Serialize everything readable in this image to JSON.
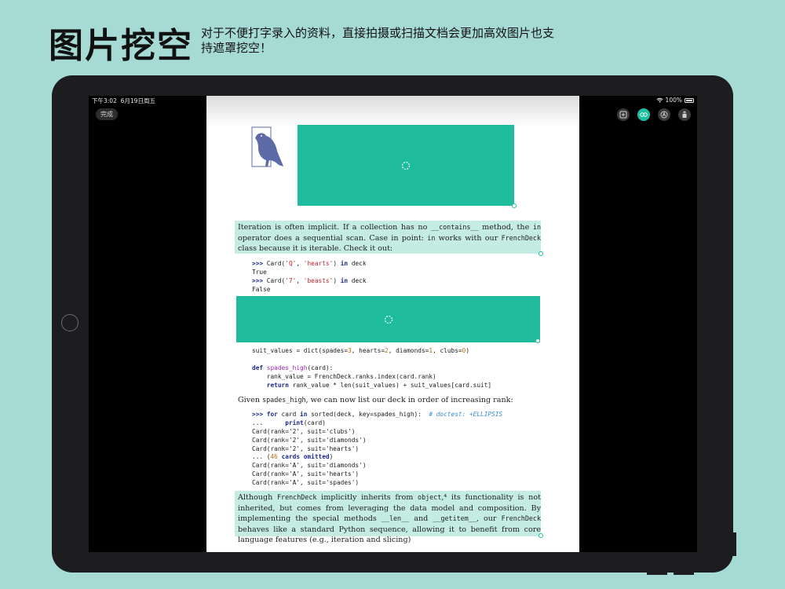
{
  "header": {
    "title": "图片挖空",
    "subtitle": "对于不便打字录入的资料，直接拍摄或扫描文档会更加高效图片也支持遮罩挖空！"
  },
  "status_bar": {
    "time": "下午3:02",
    "date": "6月19日周五",
    "battery": "100%"
  },
  "toolbar": {
    "done_label": "完成",
    "tools": [
      "add-icon",
      "mask-icon",
      "pen-icon",
      "share-icon"
    ],
    "active_tool": "mask-icon"
  },
  "colors": {
    "background": "#a6dad5",
    "mask": "#1ebc9d",
    "highlight": "#c4ece2"
  },
  "document": {
    "para1": {
      "t1": "Iteration is often implicit. If a collection has no ",
      "c1": "__contains__",
      "t2": " method, the ",
      "c2": "in",
      "t3": " operator does a sequential scan. Case in point: ",
      "c3": "in",
      "t4": " works with our ",
      "c4": "FrenchDeck",
      "t5": " class because it is iterable. Check it out:"
    },
    "code1": [
      [
        {
          "c": "kw",
          "t": ">>> "
        },
        {
          "c": "",
          "t": "Card("
        },
        {
          "c": "str",
          "t": "'Q'"
        },
        {
          "c": "",
          "t": ", "
        },
        {
          "c": "str",
          "t": "'hearts'"
        },
        {
          "c": "",
          "t": ") "
        },
        {
          "c": "kw",
          "t": "in"
        },
        {
          "c": "",
          "t": " deck"
        }
      ],
      [
        {
          "c": "",
          "t": "True"
        }
      ],
      [
        {
          "c": "kw",
          "t": ">>> "
        },
        {
          "c": "",
          "t": "Card("
        },
        {
          "c": "str",
          "t": "'7'"
        },
        {
          "c": "",
          "t": ", "
        },
        {
          "c": "str",
          "t": "'beasts'"
        },
        {
          "c": "",
          "t": ") "
        },
        {
          "c": "kw",
          "t": "in"
        },
        {
          "c": "",
          "t": " deck"
        }
      ],
      [
        {
          "c": "",
          "t": "False"
        }
      ]
    ],
    "code2": [
      [
        {
          "c": "",
          "t": "suit_values = dict(spades="
        },
        {
          "c": "num",
          "t": "3"
        },
        {
          "c": "",
          "t": ", hearts="
        },
        {
          "c": "num",
          "t": "2"
        },
        {
          "c": "",
          "t": ", diamonds="
        },
        {
          "c": "num",
          "t": "1"
        },
        {
          "c": "",
          "t": ", clubs="
        },
        {
          "c": "num",
          "t": "0"
        },
        {
          "c": "",
          "t": ")"
        }
      ],
      [
        {
          "c": "",
          "t": " "
        }
      ],
      [
        {
          "c": "kw",
          "t": "def"
        },
        {
          "c": "",
          "t": " "
        },
        {
          "c": "fn",
          "t": "spades_high"
        },
        {
          "c": "",
          "t": "(card):"
        }
      ],
      [
        {
          "c": "",
          "t": "    rank_value = FrenchDeck.ranks.index(card.rank)"
        }
      ],
      [
        {
          "c": "",
          "t": "    "
        },
        {
          "c": "kw",
          "t": "return"
        },
        {
          "c": "",
          "t": " rank_value * len(suit_values) + suit_values[card.suit]"
        }
      ]
    ],
    "para2": {
      "t1": "Given ",
      "c1": "spades_high",
      "t2": ", we can now list our deck in order of increasing rank:"
    },
    "code3": [
      [
        {
          "c": "kw",
          "t": ">>> for"
        },
        {
          "c": "",
          "t": " card "
        },
        {
          "c": "kw",
          "t": "in"
        },
        {
          "c": "",
          "t": " sorted(deck, key=spades_high):  "
        },
        {
          "c": "cm",
          "t": "# doctest: +ELLIPSIS"
        }
      ],
      [
        {
          "c": "",
          "t": "...      "
        },
        {
          "c": "kw",
          "t": "print"
        },
        {
          "c": "",
          "t": "(card)"
        }
      ],
      [
        {
          "c": "",
          "t": "Card(rank='2', suit='clubs')"
        }
      ],
      [
        {
          "c": "",
          "t": "Card(rank='2', suit='diamonds')"
        }
      ],
      [
        {
          "c": "",
          "t": "Card(rank='2', suit='hearts')"
        }
      ],
      [
        {
          "c": "",
          "t": "... ("
        },
        {
          "c": "num",
          "t": "46"
        },
        {
          "c": "kw",
          "t": " cards omitted"
        },
        {
          "c": "",
          "t": ")"
        }
      ],
      [
        {
          "c": "",
          "t": "Card(rank='A', suit='diamonds')"
        }
      ],
      [
        {
          "c": "",
          "t": "Card(rank='A', suit='hearts')"
        }
      ],
      [
        {
          "c": "",
          "t": "Card(rank='A', suit='spades')"
        }
      ]
    ],
    "para3": {
      "t1": "Although ",
      "c1": "FrenchDeck",
      "t2": " implicitly inherits from ",
      "c2": "object",
      "t3": ",⁴ its functionality is not inherited, but comes from leveraging the data model and composition. By implementing the special methods ",
      "c3": "__len__",
      "t4": " and ",
      "c4": "__getitem__",
      "t5": ", our ",
      "c5": "FrenchDeck",
      "t6": " behaves like a standard Python sequence, allowing it to benefit from core language features (e.g., iteration and slicing)"
    }
  }
}
